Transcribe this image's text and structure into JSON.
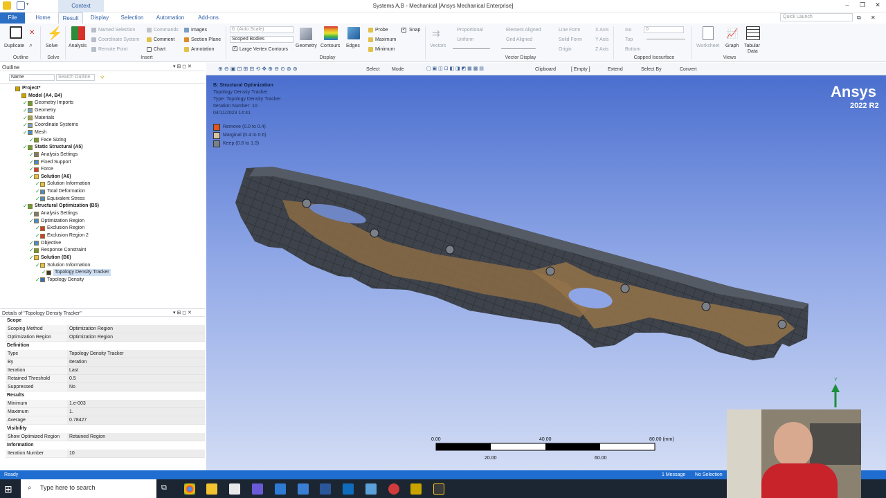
{
  "window": {
    "title": "Systems A,B - Mechanical [Ansys Mechanical Enterprise]",
    "context_tab": "Context",
    "controls": [
      "–",
      "❐",
      "✕"
    ],
    "sub_controls": [
      "–",
      "⧉",
      "✕"
    ]
  },
  "tabs": [
    "File",
    "Home",
    "Result",
    "Display",
    "Selection",
    "Automation",
    "Add-ons"
  ],
  "quick_launch": "Quick Launch",
  "ribbon": {
    "outline": {
      "duplicate": "Duplicate",
      "label": "Outline"
    },
    "solve": {
      "solve": "Solve",
      "label": "Solve"
    },
    "insert": {
      "analysis": "Analysis",
      "named_selection": "Named Selection",
      "coordinate_system": "Coordinate System",
      "remote_point": "Remote Point",
      "commands": "Commands",
      "comment": "Comment",
      "chart": "Chart",
      "images": "Images",
      "section_plane": "Section Plane",
      "annotation": "Annotation",
      "label": "Insert"
    },
    "display": {
      "scale": "0. (Auto Scale)",
      "bodies": "Scoped Bodies",
      "large_vertex": "Large Vertex Contours",
      "geometry": "Geometry",
      "contours": "Contours",
      "edges": "Edges",
      "probe": "Probe",
      "maximum": "Maximum",
      "minimum": "Minimum",
      "snap": "Snap",
      "label": "Display"
    },
    "vector": {
      "vectors": "Vectors",
      "proportional": "Proportional",
      "uniform": "Uniform",
      "element_aligned": "Element Aligned",
      "grid_aligned": "Grid Aligned",
      "line_form": "Line Form",
      "solid_form": "Solid Form",
      "origin": "Origin",
      "x_axis": "X Axis",
      "y_axis": "Y Axis",
      "z_axis": "Z Axis",
      "label": "Vector Display"
    },
    "capped": {
      "iso": "Iso",
      "top": "Top",
      "bottom": "Bottom",
      "value": "0",
      "label": "Capped Isosurface"
    },
    "views": {
      "worksheet": "Worksheet",
      "graph": "Graph",
      "tabular": "Tabular",
      "tabular2": "Data",
      "label": "Views"
    }
  },
  "outline": {
    "title": "Outline",
    "name_combo": "Name",
    "search": "Search Outline",
    "tree": [
      {
        "label": "Project*",
        "bold": true
      },
      {
        "label": "Model (A4, B4)",
        "bold": true
      },
      {
        "label": "Geometry Imports",
        "bold": false
      },
      {
        "label": "Geometry",
        "bold": false
      },
      {
        "label": "Materials",
        "bold": false
      },
      {
        "label": "Coordinate Systems",
        "bold": false
      },
      {
        "label": "Mesh",
        "bold": false
      },
      {
        "label": "Face Sizing",
        "bold": false
      },
      {
        "label": "Static Structural (A5)",
        "bold": true
      },
      {
        "label": "Analysis Settings",
        "bold": false
      },
      {
        "label": "Fixed Support",
        "bold": false
      },
      {
        "label": "Force",
        "bold": false
      },
      {
        "label": "Solution (A6)",
        "bold": true
      },
      {
        "label": "Solution Information",
        "bold": false
      },
      {
        "label": "Total Deformation",
        "bold": false
      },
      {
        "label": "Equivalent Stress",
        "bold": false
      },
      {
        "label": "Structural Optimization (B5)",
        "bold": true
      },
      {
        "label": "Analysis Settings",
        "bold": false
      },
      {
        "label": "Optimization Region",
        "bold": false
      },
      {
        "label": "Exclusion Region",
        "bold": false
      },
      {
        "label": "Exclusion Region 2",
        "bold": false
      },
      {
        "label": "Objective",
        "bold": false
      },
      {
        "label": "Response Constraint",
        "bold": false
      },
      {
        "label": "Solution (B6)",
        "bold": true
      },
      {
        "label": "Solution Information",
        "bold": false
      },
      {
        "label": "Topology Density Tracker",
        "bold": false
      },
      {
        "label": "Topology Density",
        "bold": false
      }
    ]
  },
  "details": {
    "title": "Details of \"Topology Density Tracker\"",
    "rows": [
      {
        "section": "Scope"
      },
      {
        "key": "Scoping Method",
        "value": "Optimization Region"
      },
      {
        "key": "Optimization Region",
        "value": "Optimization Region"
      },
      {
        "section": "Definition"
      },
      {
        "key": "Type",
        "value": "Topology Density Tracker"
      },
      {
        "key": "By",
        "value": "Iteration"
      },
      {
        "key": "Iteration",
        "value": "Last"
      },
      {
        "key": "Retained Threshold",
        "value": "0.5"
      },
      {
        "key": "Suppressed",
        "value": "No"
      },
      {
        "section": "Results"
      },
      {
        "key": "Minimum",
        "value": "1.e-003"
      },
      {
        "key": "Maximum",
        "value": "1."
      },
      {
        "key": "Average",
        "value": "0.78427"
      },
      {
        "section": "Visibility"
      },
      {
        "key": "Show Optimized Region",
        "value": "Retained Region"
      },
      {
        "section": "Information"
      },
      {
        "key": "Iteration Number",
        "value": "10"
      }
    ]
  },
  "graphics_toolbar": {
    "select": "Select",
    "mode": "Mode",
    "clipboard": "Clipboard",
    "empty": "[ Empty ]",
    "extend": "Extend",
    "select_by": "Select By",
    "convert": "Convert"
  },
  "viewport": {
    "header": {
      "title": "B: Structural Optimization",
      "lines": [
        "Topology Density Tracker",
        "Type: Topology Density Tracker",
        "Iteration Number: 10",
        "04/11/2023 14:41"
      ]
    },
    "legend": [
      {
        "label": "Remove (0.0 to 0.4)",
        "color": "#e0561d"
      },
      {
        "label": "Marginal (0.4 to 0.6)",
        "color": "#d9c3a0"
      },
      {
        "label": "Keep (0.6 to 1.0)",
        "color": "#7a8088"
      }
    ],
    "brand": "Ansys",
    "version": "2022 R2",
    "scale_bar": {
      "top": [
        "0.00",
        "40.00",
        "80.00 (mm)"
      ],
      "bottom": [
        "20.00",
        "60.00"
      ]
    },
    "axis_label": "Y"
  },
  "status": {
    "ready": "Ready",
    "messages": "1 Message",
    "selection": "No Selection"
  },
  "taskbar": {
    "search": "Type here to search"
  },
  "colors": {
    "accent": "#2b6fc4",
    "status_bar": "#1f6dd0",
    "body_dark": "#3a3f47",
    "body_retained": "#8a6b45"
  }
}
